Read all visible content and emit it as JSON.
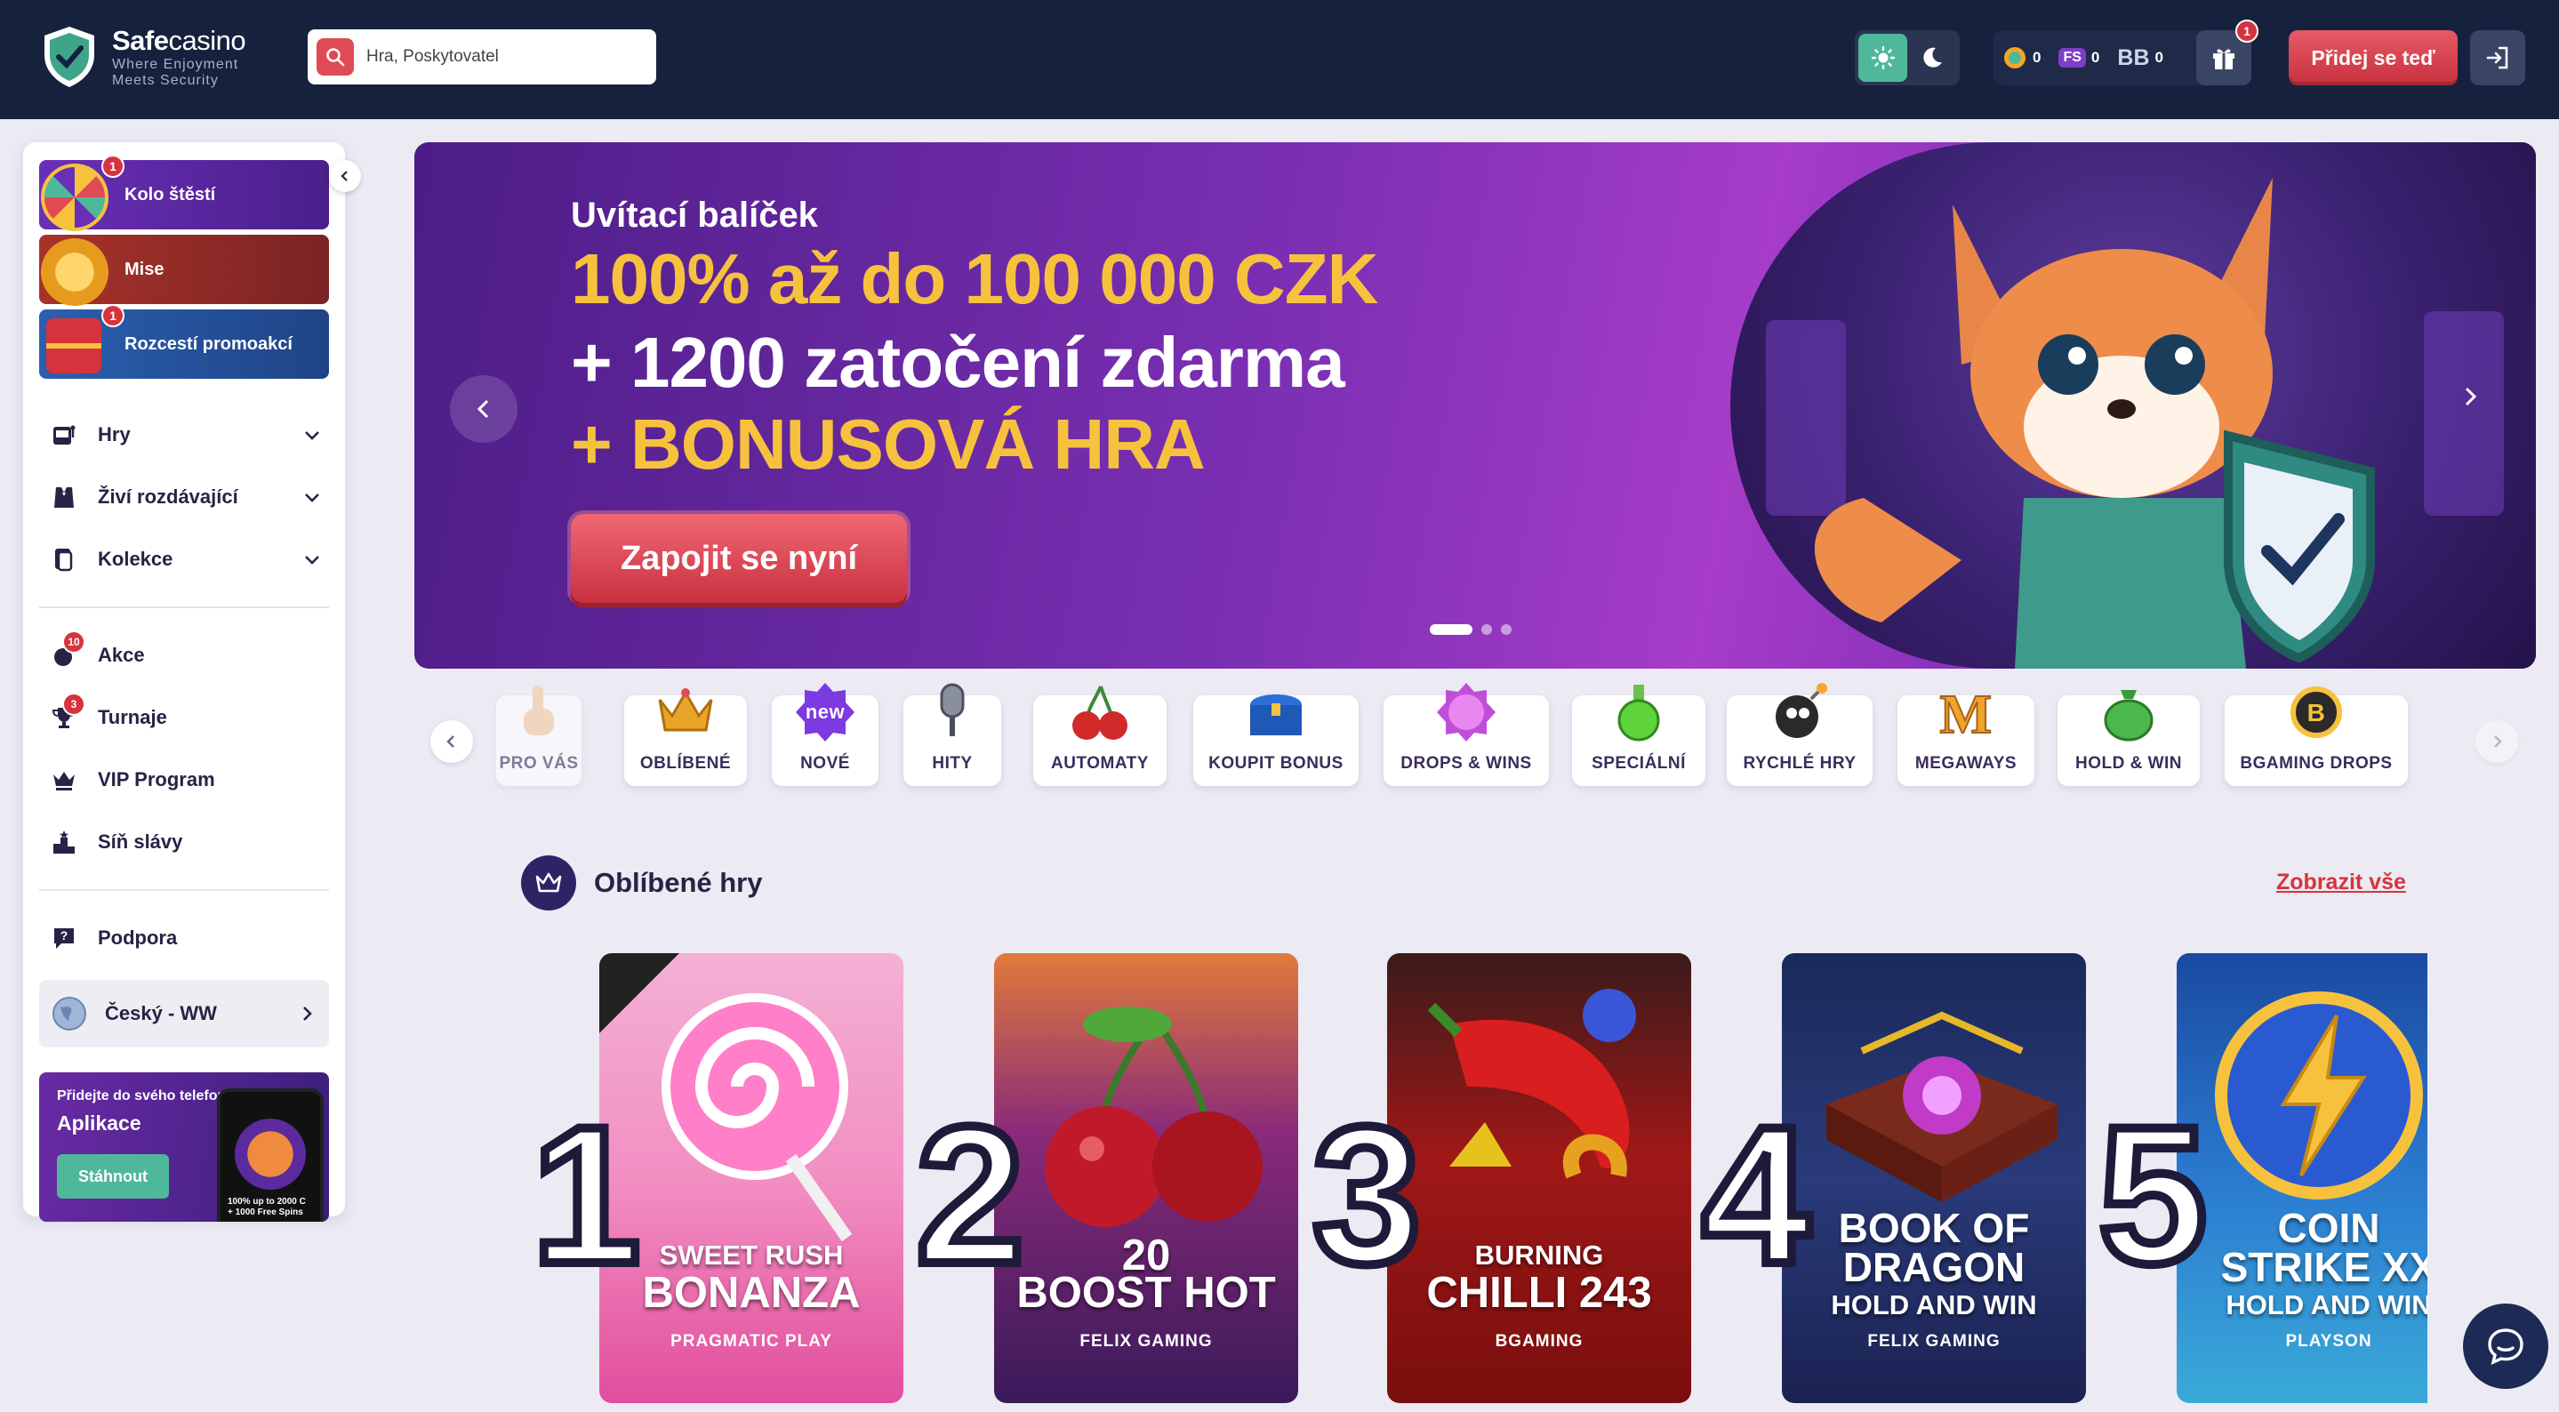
{
  "header": {
    "brand_bold": "Safe",
    "brand_regular": "casino",
    "tagline_1": "Where Enjoyment",
    "tagline_2": "Meets Security",
    "search_placeholder": "Hra, Poskytovatel",
    "wallet": {
      "coins": "0",
      "fs_label": "FS",
      "fs": "0",
      "bb_label": "BB",
      "bb": "0"
    },
    "gift_badge": "1",
    "join_label": "Přidej se teď"
  },
  "sidebar": {
    "promos": [
      {
        "label": "Kolo štěstí",
        "badge": "1"
      },
      {
        "label": "Mise",
        "badge": ""
      },
      {
        "label": "Rozcestí promoakcí",
        "badge": "1"
      }
    ],
    "nav_main": [
      {
        "label": "Hry"
      },
      {
        "label": "Živí rozdávající"
      },
      {
        "label": "Kolekce"
      }
    ],
    "nav_secondary": [
      {
        "label": "Akce",
        "badge": "10"
      },
      {
        "label": "Turnaje",
        "badge": "3"
      },
      {
        "label": "VIP Program"
      },
      {
        "label": "Síň slávy"
      }
    ],
    "support_label": "Podpora",
    "language_label": "Český - WW",
    "app_card": {
      "small": "Přidejte do svého telefonu",
      "title": "Aplikace",
      "button": "Stáhnout",
      "phone_text_1": "100% up to 2000 C",
      "phone_text_2": "+ 1000 Free Spins"
    }
  },
  "hero": {
    "subtitle": "Uvítací balíček",
    "line1": "100% až do 100 000 CZK",
    "line2": "+ 1200 zatočení zdarma",
    "line3": "+ BONUSOVÁ HRA",
    "cta": "Zapojit se nyní",
    "slides": 3,
    "active_slide": 1
  },
  "categories": [
    {
      "label": "PRO VÁS",
      "icon": "pointing-hand-icon"
    },
    {
      "label": "OBLÍBENÉ",
      "icon": "crown-icon"
    },
    {
      "label": "NOVÉ",
      "icon": "new-badge-icon",
      "icon_text": "new"
    },
    {
      "label": "HITY",
      "icon": "microphone-icon"
    },
    {
      "label": "AUTOMATY",
      "icon": "cherries-icon"
    },
    {
      "label": "KOUPIT BONUS",
      "icon": "treasure-chest-icon"
    },
    {
      "label": "DROPS & WINS",
      "icon": "drops-wins-icon"
    },
    {
      "label": "SPECIÁLNÍ",
      "icon": "potion-icon"
    },
    {
      "label": "RYCHLÉ HRY",
      "icon": "bomb-icon"
    },
    {
      "label": "MEGAWAYS",
      "icon": "megaways-m-icon",
      "icon_text": "M"
    },
    {
      "label": "HOLD & WIN",
      "icon": "money-bag-icon"
    },
    {
      "label": "BGAMING DROPS",
      "icon": "bgaming-coin-icon"
    }
  ],
  "favourites": {
    "title": "Oblíbené hry",
    "show_all": "Zobrazit vše",
    "games": [
      {
        "rank": "1",
        "title_small": "SWEET RUSH",
        "title_big": "BONANZA",
        "title_sub": "",
        "provider": "PRAGMATIC PLAY"
      },
      {
        "rank": "2",
        "title_small": "20",
        "title_big": "BOOST HOT",
        "title_sub": "",
        "provider": "FELIX GAMING"
      },
      {
        "rank": "3",
        "title_small": "BURNING",
        "title_big": "CHILLI 243",
        "title_sub": "",
        "provider": "BGAMING"
      },
      {
        "rank": "4",
        "title_small": "BOOK OF",
        "title_big": "DRAGON",
        "title_sub": "HOLD AND WIN",
        "provider": "FELIX GAMING"
      },
      {
        "rank": "5",
        "title_small": "COIN",
        "title_big": "STRIKE XX",
        "title_sub": "HOLD AND WIN",
        "provider": "PLAYSON"
      }
    ]
  },
  "colors": {
    "header_bg": "#16213e",
    "accent_red": "#d5343e",
    "accent_green": "#4fb89a",
    "gold": "#f6c23e"
  }
}
